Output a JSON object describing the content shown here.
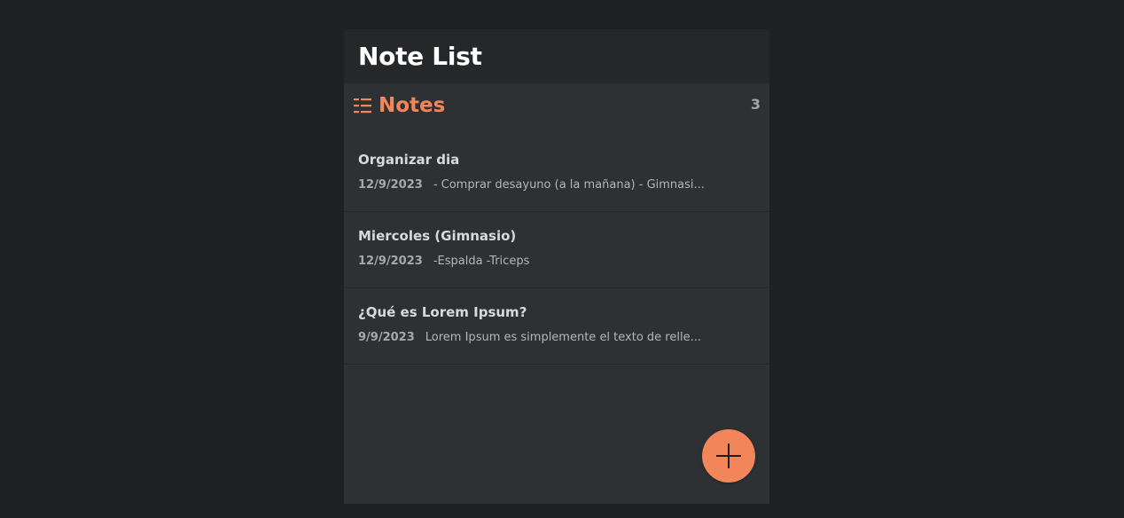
{
  "header": {
    "title": "Note List"
  },
  "section": {
    "label": "Notes",
    "count": "3",
    "icon": "list-icon"
  },
  "notes": [
    {
      "title": "Organizar dia",
      "date": "12/9/2023",
      "preview": "- Comprar desayuno (a la mañana) - Gimnasi..."
    },
    {
      "title": "Miercoles (Gimnasio)",
      "date": "12/9/2023",
      "preview": "-Espalda -Triceps"
    },
    {
      "title": "¿Qué es Lorem Ipsum?",
      "date": "9/9/2023",
      "preview": "Lorem Ipsum es simplemente el texto de relle..."
    }
  ],
  "fab": {
    "icon": "plus-icon"
  },
  "colors": {
    "accent": "#f2865a",
    "background": "#1f2023",
    "panel": "#2e3134",
    "header": "#252729"
  }
}
